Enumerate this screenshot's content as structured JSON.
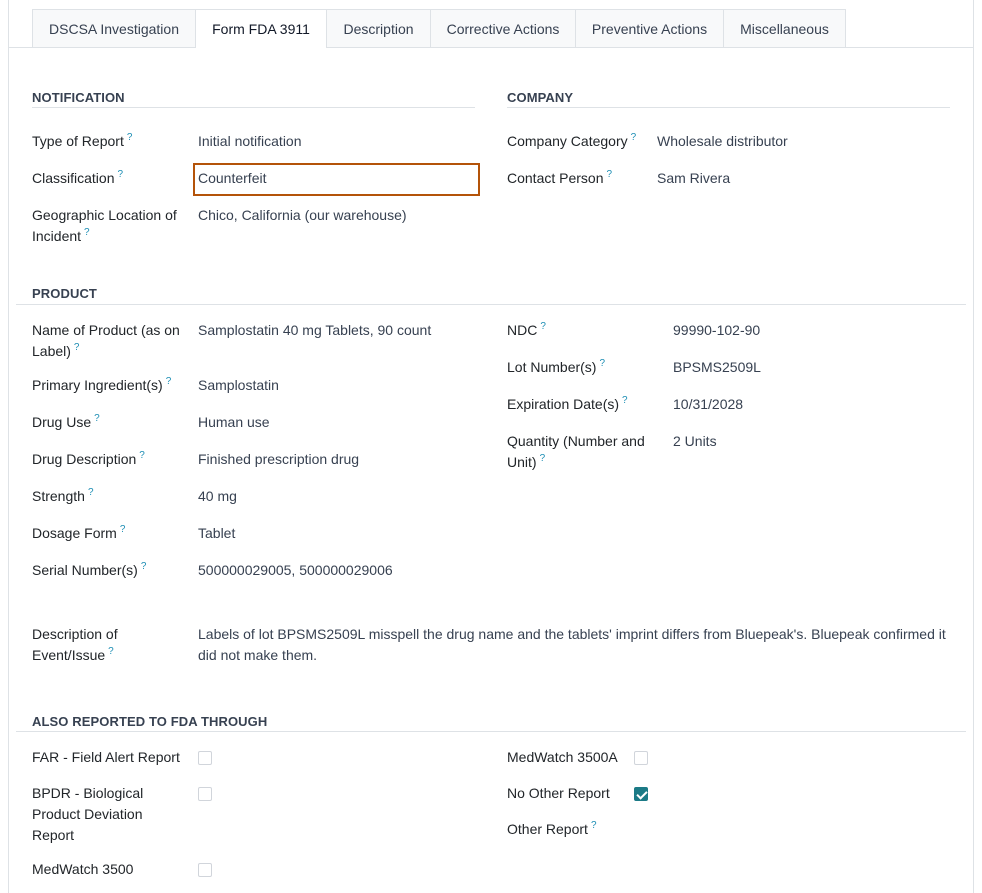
{
  "tabs": [
    {
      "label": "DSCSA Investigation"
    },
    {
      "label": "Form FDA 3911"
    },
    {
      "label": "Description"
    },
    {
      "label": "Corrective Actions"
    },
    {
      "label": "Preventive Actions"
    },
    {
      "label": "Miscellaneous"
    }
  ],
  "active_tab": "Form FDA 3911",
  "help_glyph": "?",
  "notification": {
    "title": "NOTIFICATION",
    "type_of_report": {
      "label": "Type of Report",
      "value": "Initial notification"
    },
    "classification": {
      "label": "Classification",
      "value": "Counterfeit"
    },
    "geo_location": {
      "label_line1": "Geographic Location of",
      "label_line2": "Incident",
      "value": "Chico, California (our warehouse)"
    }
  },
  "company": {
    "title": "COMPANY",
    "category": {
      "label": "Company Category",
      "value": "Wholesale distributor"
    },
    "contact": {
      "label": "Contact Person",
      "value": "Sam Rivera"
    }
  },
  "product": {
    "title": "PRODUCT",
    "name": {
      "label_line1": "Name of Product (as on",
      "label_line2": "Label)",
      "value": "Samplostatin 40 mg Tablets, 90 count"
    },
    "primary_ingredient": {
      "label": "Primary Ingredient(s)",
      "value": "Samplostatin"
    },
    "drug_use": {
      "label": "Drug Use",
      "value": "Human use"
    },
    "drug_description": {
      "label": "Drug Description",
      "value": "Finished prescription drug"
    },
    "strength": {
      "label": "Strength",
      "value": "40 mg"
    },
    "dosage_form": {
      "label": "Dosage Form",
      "value": "Tablet"
    },
    "serial_numbers": {
      "label": "Serial Number(s)",
      "value": "500000029005, 500000029006"
    },
    "ndc": {
      "label": "NDC",
      "value": "99990-102-90"
    },
    "lot_numbers": {
      "label": "Lot Number(s)",
      "value": "BPSMS2509L"
    },
    "expiration": {
      "label": "Expiration Date(s)",
      "value": "10/31/2028"
    },
    "quantity": {
      "label_line1": "Quantity (Number and",
      "label_line2": "Unit)",
      "value": "2 Units"
    }
  },
  "event": {
    "label_line1": "Description of",
    "label_line2": "Event/Issue",
    "value_line1": "Labels of lot BPSMS2509L misspell the drug name and the tablets' imprint differs from Bluepeak's. Bluepeak confirmed it",
    "value_line2": "did not make them."
  },
  "also_reported": {
    "title": "ALSO REPORTED TO FDA THROUGH",
    "far": {
      "label": "FAR - Field Alert Report",
      "checked": false
    },
    "bpdr": {
      "label_line1": "BPDR - Biological",
      "label_line2": "Product Deviation",
      "label_line3": "Report",
      "checked": false
    },
    "medwatch_3500": {
      "label": "MedWatch 3500",
      "checked": false
    },
    "medwatch_3500a": {
      "label": "MedWatch 3500A",
      "checked": false
    },
    "no_other": {
      "label": "No Other Report",
      "checked": true
    },
    "other": {
      "label": "Other Report"
    }
  },
  "colors": {
    "accent": "#1b7a86",
    "highlight_border": "#b45309",
    "help": "#1f8fb5"
  }
}
